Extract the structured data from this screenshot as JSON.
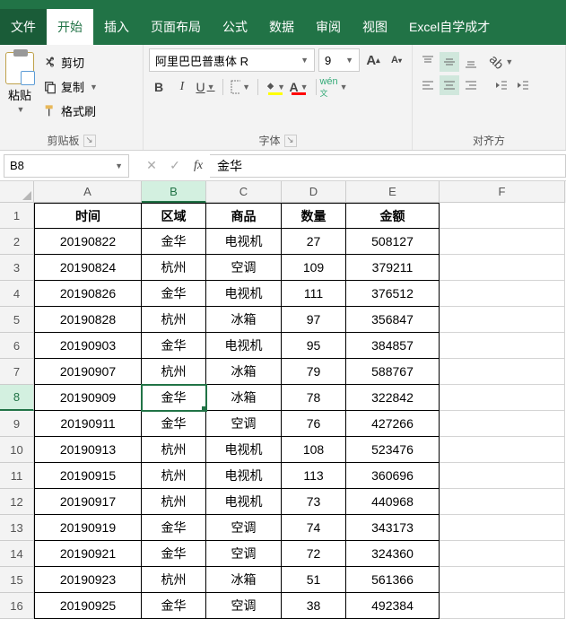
{
  "menu": {
    "file": "文件",
    "home": "开始",
    "insert": "插入",
    "layout": "页面布局",
    "formula": "公式",
    "data": "数据",
    "review": "审阅",
    "view": "视图",
    "custom": "Excel自学成才"
  },
  "ribbon": {
    "paste": "粘贴",
    "cut": "剪切",
    "copy": "复制",
    "painter": "格式刷",
    "clipboard_label": "剪贴板",
    "font_label": "字体",
    "align_label": "对齐方",
    "font_name": "阿里巴巴普惠体 R",
    "font_size": "9"
  },
  "namebox": "B8",
  "formula": "金华",
  "cols": [
    "A",
    "B",
    "C",
    "D",
    "E",
    "F"
  ],
  "headers": {
    "A": "时间",
    "B": "区域",
    "C": "商品",
    "D": "数量",
    "E": "金额"
  },
  "chart_data": {
    "type": "table",
    "columns": [
      "时间",
      "区域",
      "商品",
      "数量",
      "金额"
    ],
    "rows": [
      [
        "20190822",
        "金华",
        "电视机",
        "27",
        "508127"
      ],
      [
        "20190824",
        "杭州",
        "空调",
        "109",
        "379211"
      ],
      [
        "20190826",
        "金华",
        "电视机",
        "111",
        "376512"
      ],
      [
        "20190828",
        "杭州",
        "冰箱",
        "97",
        "356847"
      ],
      [
        "20190903",
        "金华",
        "电视机",
        "95",
        "384857"
      ],
      [
        "20190907",
        "杭州",
        "冰箱",
        "79",
        "588767"
      ],
      [
        "20190909",
        "金华",
        "冰箱",
        "78",
        "322842"
      ],
      [
        "20190911",
        "金华",
        "空调",
        "76",
        "427266"
      ],
      [
        "20190913",
        "杭州",
        "电视机",
        "108",
        "523476"
      ],
      [
        "20190915",
        "杭州",
        "电视机",
        "113",
        "360696"
      ],
      [
        "20190917",
        "杭州",
        "电视机",
        "73",
        "440968"
      ],
      [
        "20190919",
        "金华",
        "空调",
        "74",
        "343173"
      ],
      [
        "20190921",
        "金华",
        "空调",
        "72",
        "324360"
      ],
      [
        "20190923",
        "杭州",
        "冰箱",
        "51",
        "561366"
      ],
      [
        "20190925",
        "金华",
        "空调",
        "38",
        "492384"
      ]
    ]
  },
  "selected": {
    "row": 8,
    "col": "B"
  }
}
